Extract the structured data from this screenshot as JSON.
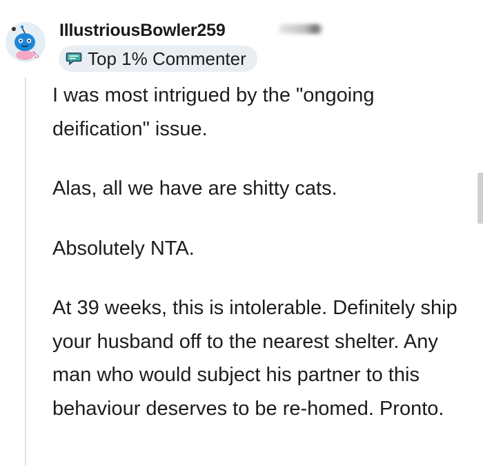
{
  "comment": {
    "username": "IllustriousBowler259",
    "flair": {
      "icon": "speech-bubble-icon",
      "label": "Top 1% Commenter"
    },
    "paragraphs": [
      "I was most intrigued by the \"ongoing deification\" issue.",
      "Alas, all we have are shitty cats.",
      "Absolutely NTA.",
      "At 39 weeks, this is intolerable. Definitely ship your husband off to the nearest shelter. Any man who would subject his partner to this behaviour deserves to be re-homed. Pronto."
    ]
  },
  "colors": {
    "avatar_blue": "#1e88d8",
    "flair_bg": "#e9eef3",
    "text": "#1c1c1c"
  }
}
